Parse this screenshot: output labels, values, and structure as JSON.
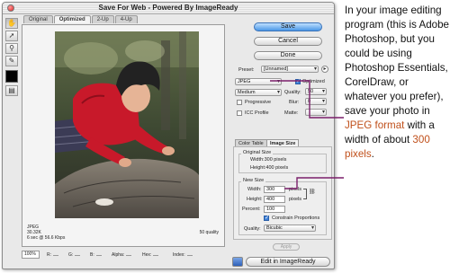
{
  "window": {
    "title": "Save For Web - Powered By ImageReady",
    "tabs": [
      "Original",
      "Optimized",
      "2-Up",
      "4-Up"
    ],
    "active_tab": "Optimized"
  },
  "tools": [
    "hand-tool",
    "slice-select-tool",
    "zoom-tool",
    "eyedropper-tool"
  ],
  "preview": {
    "format": "JPEG",
    "file_size": "30.32K",
    "download_time": "6 sec @ 56.6 Kbps",
    "quality_note": "50 quality"
  },
  "status_bar": {
    "zoom": "100%",
    "channels": [
      "R:",
      "G:",
      "B:",
      "Alpha:",
      "Hex:",
      "Index:"
    ]
  },
  "buttons": {
    "save": "Save",
    "cancel": "Cancel",
    "done": "Done",
    "apply": "Apply",
    "edit_in": "Edit in ImageReady"
  },
  "settings": {
    "preset_label": "Preset:",
    "preset_value": "[Unnamed]",
    "format": "JPEG",
    "optimized_label": "Optimized",
    "optimized_checked": true,
    "compression": "Medium",
    "quality_label": "Quality:",
    "quality_value": "50",
    "progressive_label": "Progressive",
    "progressive_checked": false,
    "blur_label": "Blur:",
    "blur_value": "0",
    "icc_label": "ICC Profile",
    "icc_checked": false,
    "matte_label": "Matte:",
    "matte_value": ""
  },
  "image_size": {
    "tabs": [
      "Color Table",
      "Image Size"
    ],
    "active_tab": "Image Size",
    "original_size_label": "Original Size",
    "original_width": "Width:300 pixels",
    "original_height": "Height:400 pixels",
    "new_size_label": "New Size",
    "width_label": "Width:",
    "width_value": "300",
    "height_label": "Height:",
    "height_value": "400",
    "percent_label": "Percent:",
    "percent_value": "100",
    "unit": "pixels",
    "constrain_label": "Constrain Proportions",
    "constrain_checked": true,
    "quality_label": "Quality:",
    "quality_value": "Bicubic"
  },
  "annotation": {
    "text_1": "In your image editing program (this is Adobe Photoshop, but you could be using Photoshop Essentials, CorelDraw, or whatever you prefer), save your photo in ",
    "jpeg_format": "JPEG format",
    "text_2": " with a width of about ",
    "width_hint": "300 pixels",
    "text_3": "."
  },
  "colors": {
    "highlight_text": "#c0501b",
    "callout_line": "#7a1f6a",
    "default_button": "#4a98e6"
  }
}
